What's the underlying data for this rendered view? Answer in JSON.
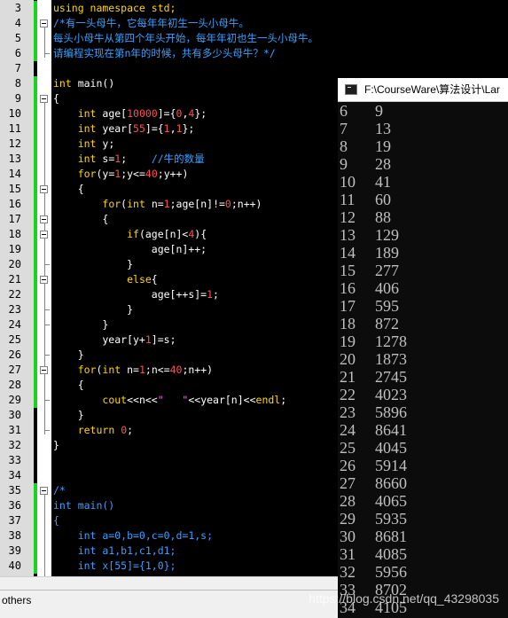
{
  "editor": {
    "line_numbers": [
      "3",
      "4",
      "5",
      "6",
      "7",
      "8",
      "9",
      "10",
      "11",
      "12",
      "13",
      "14",
      "15",
      "16",
      "17",
      "18",
      "19",
      "20",
      "21",
      "22",
      "23",
      "24",
      "25",
      "26",
      "27",
      "28",
      "29",
      "30",
      "31",
      "32",
      "33",
      "34",
      "35",
      "36",
      "37",
      "38",
      "39",
      "40"
    ],
    "lines": [
      [
        {
          "t": "using namespace std;",
          "c": "kw"
        }
      ],
      [
        {
          "t": "/*有一头母牛，它每年年初生一头小母牛。",
          "c": "cmt"
        }
      ],
      [
        {
          "t": "每头小母牛从第四个年头开始，每年年初也生一头小母牛。",
          "c": "cmt"
        }
      ],
      [
        {
          "t": "请编程实现在第n年的时候，共有多少头母牛？*/",
          "c": "cmt"
        }
      ],
      [],
      [
        {
          "t": "int",
          "c": "kw"
        },
        {
          "t": " main()",
          "c": ""
        }
      ],
      [
        {
          "t": "{",
          "c": ""
        }
      ],
      [
        {
          "t": "    ",
          "c": ""
        },
        {
          "t": "int",
          "c": "kw"
        },
        {
          "t": " age[",
          "c": ""
        },
        {
          "t": "10000",
          "c": "num"
        },
        {
          "t": "]={",
          "c": ""
        },
        {
          "t": "0",
          "c": "num"
        },
        {
          "t": ",",
          "c": ""
        },
        {
          "t": "4",
          "c": "num"
        },
        {
          "t": "};",
          "c": ""
        }
      ],
      [
        {
          "t": "    ",
          "c": ""
        },
        {
          "t": "int",
          "c": "kw"
        },
        {
          "t": " year[",
          "c": ""
        },
        {
          "t": "55",
          "c": "num"
        },
        {
          "t": "]={",
          "c": ""
        },
        {
          "t": "1",
          "c": "num"
        },
        {
          "t": ",",
          "c": ""
        },
        {
          "t": "1",
          "c": "num"
        },
        {
          "t": "};",
          "c": ""
        }
      ],
      [
        {
          "t": "    ",
          "c": ""
        },
        {
          "t": "int",
          "c": "kw"
        },
        {
          "t": " y;",
          "c": ""
        }
      ],
      [
        {
          "t": "    ",
          "c": ""
        },
        {
          "t": "int",
          "c": "kw"
        },
        {
          "t": " s=",
          "c": ""
        },
        {
          "t": "1",
          "c": "num"
        },
        {
          "t": ";    ",
          "c": ""
        },
        {
          "t": "//牛的数量",
          "c": "cmt"
        }
      ],
      [
        {
          "t": "    ",
          "c": ""
        },
        {
          "t": "for",
          "c": "kw"
        },
        {
          "t": "(y=",
          "c": ""
        },
        {
          "t": "1",
          "c": "num"
        },
        {
          "t": ";y<=",
          "c": ""
        },
        {
          "t": "40",
          "c": "num"
        },
        {
          "t": ";y++)",
          "c": ""
        }
      ],
      [
        {
          "t": "    {",
          "c": ""
        }
      ],
      [
        {
          "t": "        ",
          "c": ""
        },
        {
          "t": "for",
          "c": "kw"
        },
        {
          "t": "(",
          "c": ""
        },
        {
          "t": "int",
          "c": "kw"
        },
        {
          "t": " n=",
          "c": ""
        },
        {
          "t": "1",
          "c": "num"
        },
        {
          "t": ";age[n]!=",
          "c": ""
        },
        {
          "t": "0",
          "c": "num"
        },
        {
          "t": ";n++)",
          "c": ""
        }
      ],
      [
        {
          "t": "        {",
          "c": ""
        }
      ],
      [
        {
          "t": "            ",
          "c": ""
        },
        {
          "t": "if",
          "c": "kw"
        },
        {
          "t": "(age[n]<",
          "c": ""
        },
        {
          "t": "4",
          "c": "num"
        },
        {
          "t": "){",
          "c": ""
        }
      ],
      [
        {
          "t": "                age[n]++;",
          "c": ""
        }
      ],
      [
        {
          "t": "            }",
          "c": ""
        }
      ],
      [
        {
          "t": "            ",
          "c": ""
        },
        {
          "t": "else",
          "c": "kw"
        },
        {
          "t": "{",
          "c": ""
        }
      ],
      [
        {
          "t": "                age[++s]=",
          "c": ""
        },
        {
          "t": "1",
          "c": "num"
        },
        {
          "t": ";",
          "c": ""
        }
      ],
      [
        {
          "t": "            }",
          "c": ""
        }
      ],
      [
        {
          "t": "        }",
          "c": ""
        }
      ],
      [
        {
          "t": "        year[y+",
          "c": ""
        },
        {
          "t": "1",
          "c": "num"
        },
        {
          "t": "]=s;",
          "c": ""
        }
      ],
      [
        {
          "t": "    }",
          "c": ""
        }
      ],
      [
        {
          "t": "    ",
          "c": ""
        },
        {
          "t": "for",
          "c": "kw"
        },
        {
          "t": "(",
          "c": ""
        },
        {
          "t": "int",
          "c": "kw"
        },
        {
          "t": " n=",
          "c": ""
        },
        {
          "t": "1",
          "c": "num"
        },
        {
          "t": ";n<=",
          "c": ""
        },
        {
          "t": "40",
          "c": "num"
        },
        {
          "t": ";n++)",
          "c": ""
        }
      ],
      [
        {
          "t": "    {",
          "c": ""
        }
      ],
      [
        {
          "t": "        ",
          "c": ""
        },
        {
          "t": "cout",
          "c": "kw"
        },
        {
          "t": "<<n<<",
          "c": ""
        },
        {
          "t": "\"   \"",
          "c": "str"
        },
        {
          "t": "<<year[n]<<",
          "c": ""
        },
        {
          "t": "endl",
          "c": "kw"
        },
        {
          "t": ";",
          "c": ""
        }
      ],
      [
        {
          "t": "    }",
          "c": ""
        }
      ],
      [
        {
          "t": "    ",
          "c": ""
        },
        {
          "t": "return",
          "c": "kw"
        },
        {
          "t": " ",
          "c": ""
        },
        {
          "t": "0",
          "c": "num"
        },
        {
          "t": ";",
          "c": ""
        }
      ],
      [
        {
          "t": "}",
          "c": ""
        }
      ],
      [],
      [],
      [
        {
          "t": "/*",
          "c": "cmt"
        }
      ],
      [
        {
          "t": "int main()",
          "c": "cmt"
        }
      ],
      [
        {
          "t": "{",
          "c": "cmt"
        }
      ],
      [
        {
          "t": "    int a=0,b=0,c=0,d=1,s;",
          "c": "cmt"
        }
      ],
      [
        {
          "t": "    int a1,b1,c1,d1;",
          "c": "cmt"
        }
      ],
      [
        {
          "t": "    int x[55]={1,0};",
          "c": "cmt"
        }
      ]
    ]
  },
  "console": {
    "title": "F:\\CourseWare\\算法设计\\Lar",
    "rows": [
      [
        "6",
        "9"
      ],
      [
        "7",
        "13"
      ],
      [
        "8",
        "19"
      ],
      [
        "9",
        "28"
      ],
      [
        "10",
        "41"
      ],
      [
        "11",
        "60"
      ],
      [
        "12",
        "88"
      ],
      [
        "13",
        "129"
      ],
      [
        "14",
        "189"
      ],
      [
        "15",
        "277"
      ],
      [
        "16",
        "406"
      ],
      [
        "17",
        "595"
      ],
      [
        "18",
        "872"
      ],
      [
        "19",
        "1278"
      ],
      [
        "20",
        "1873"
      ],
      [
        "21",
        "2745"
      ],
      [
        "22",
        "4023"
      ],
      [
        "23",
        "5896"
      ],
      [
        "24",
        "8641"
      ],
      [
        "25",
        "4045"
      ],
      [
        "26",
        "5914"
      ],
      [
        "27",
        "8660"
      ],
      [
        "28",
        "4065"
      ],
      [
        "29",
        "5935"
      ],
      [
        "30",
        "8681"
      ],
      [
        "31",
        "4085"
      ],
      [
        "32",
        "5956"
      ],
      [
        "33",
        "8702"
      ],
      [
        "34",
        "4105"
      ]
    ]
  },
  "statusbar": {
    "label": "others"
  },
  "watermark": "https://blog.csdn.net/qq_43298035",
  "colors": {
    "keyword": "#ffd700",
    "number": "#ff5050",
    "comment": "#3aa0ff",
    "string": "#ff66ff",
    "change_bar": "#19d41c"
  }
}
